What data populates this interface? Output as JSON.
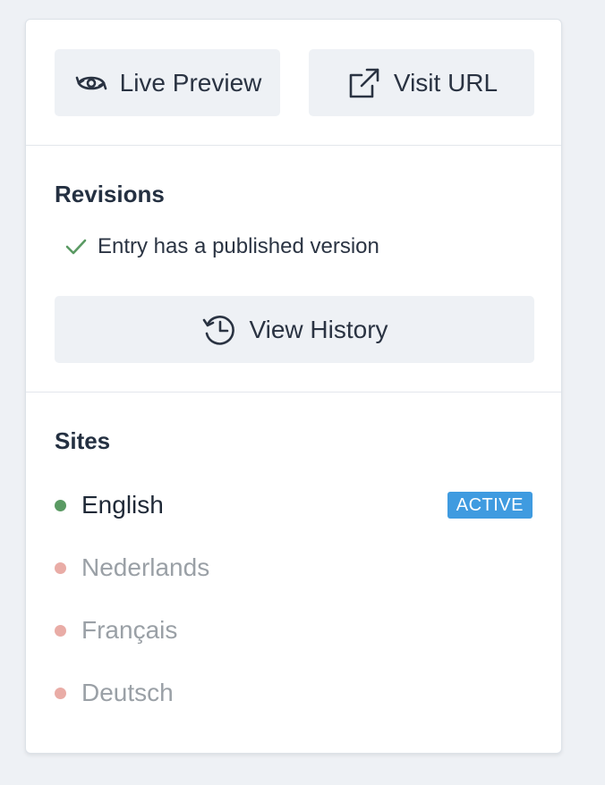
{
  "toolbar": {
    "live_preview_label": "Live Preview",
    "live_preview_icon": "live-preview-icon",
    "visit_url_label": "Visit URL",
    "visit_url_icon": "external-link-icon"
  },
  "revisions": {
    "heading": "Revisions",
    "status_text": "Entry has a published version",
    "status_icon": "check-icon",
    "view_history_label": "View History",
    "view_history_icon": "history-icon"
  },
  "sites": {
    "heading": "Sites",
    "items": [
      {
        "name": "English",
        "status_color": "#5a9a63",
        "text_color": "#1f2937",
        "badge": "ACTIVE"
      },
      {
        "name": "Nederlands",
        "status_color": "#e9aca6",
        "text_color": "#9aa0a6"
      },
      {
        "name": "Français",
        "status_color": "#e9aca6",
        "text_color": "#9aa0a6"
      },
      {
        "name": "Deutsch",
        "status_color": "#e9aca6",
        "text_color": "#9aa0a6"
      }
    ]
  },
  "colors": {
    "background": "#eef1f5",
    "panel": "#ffffff",
    "button_bg": "#eef1f5",
    "badge_bg": "#3f9be0",
    "check_green": "#5a9a63"
  }
}
